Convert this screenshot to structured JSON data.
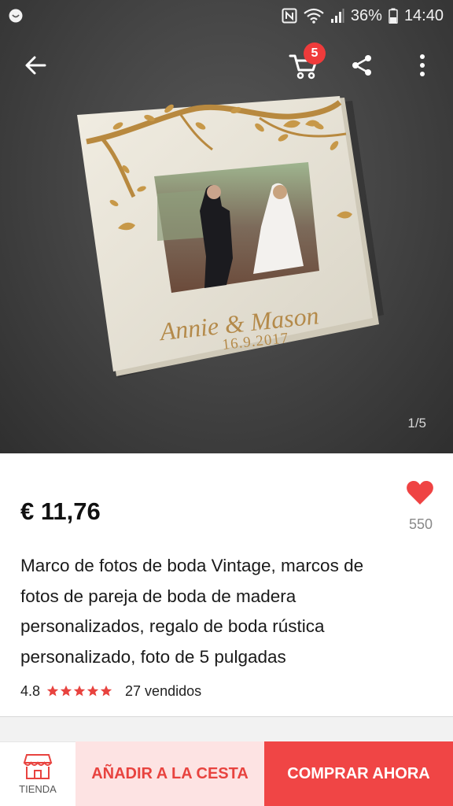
{
  "status_bar": {
    "battery_percent": "36%",
    "time": "14:40",
    "icons": [
      "notification-icon",
      "nfc-icon",
      "wifi-icon",
      "signal-icon",
      "battery-icon"
    ]
  },
  "toolbar": {
    "cart_count": "5",
    "icons": [
      "back-arrow-icon",
      "cart-icon",
      "share-icon",
      "more-vert-icon"
    ]
  },
  "product_image": {
    "counter": "1/5",
    "engraving_names": "Annie & Mason",
    "engraving_date": "16.9.2017"
  },
  "product": {
    "price": "€ 11,76",
    "wishlist_count": "550",
    "title": "Marco de fotos de boda Vintage, marcos de fotos de pareja de boda de madera personalizados, regalo de boda rústica personalizado, foto de 5 pulgadas",
    "rating": "4.8",
    "stars": 5,
    "sold": "27 vendidos"
  },
  "bottom_bar": {
    "store_label": "TIENDA",
    "add_to_cart_label": "AÑADIR A LA CESTA",
    "buy_now_label": "COMPRAR AHORA"
  },
  "colors": {
    "accent": "#f04545",
    "accent_light": "#fde3e3",
    "star": "#e8433f",
    "heart": "#ef4343"
  }
}
